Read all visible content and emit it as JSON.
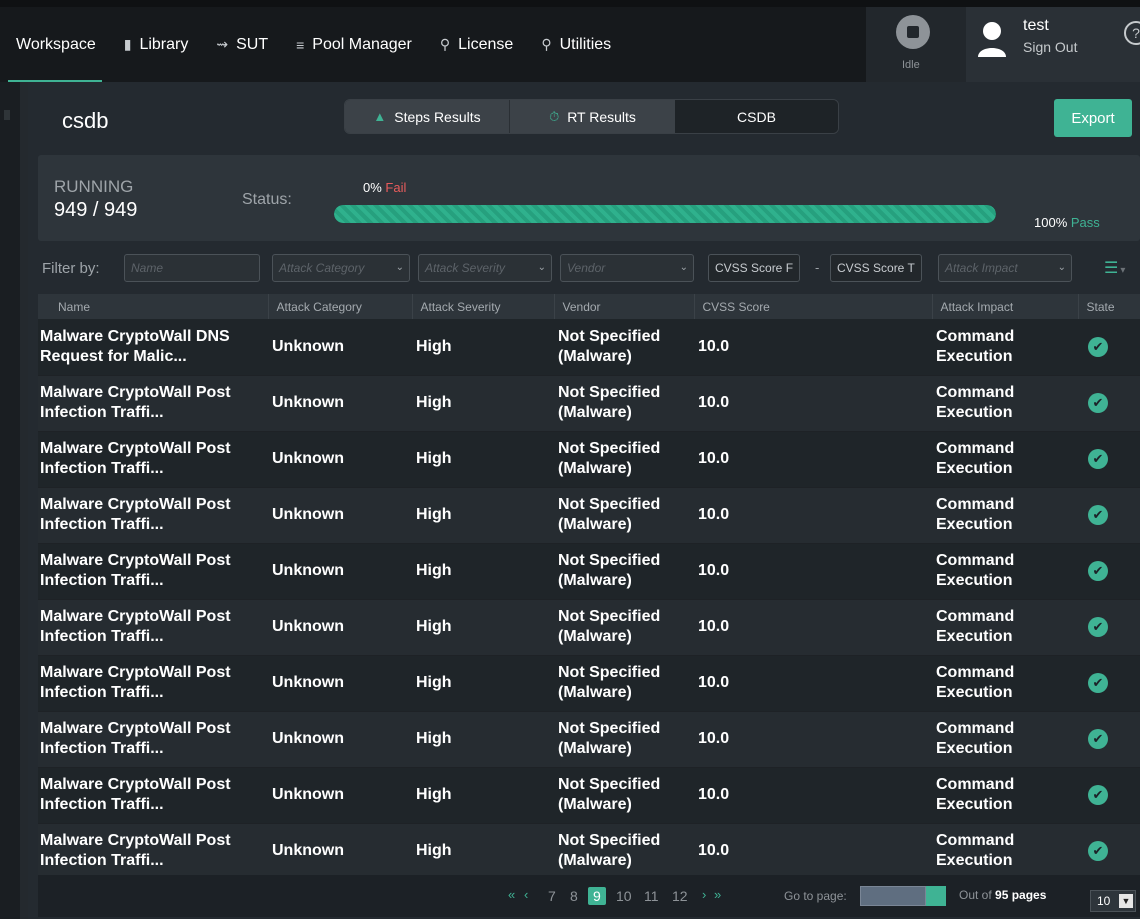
{
  "nav": {
    "items": [
      {
        "label": "Workspace",
        "icon": ""
      },
      {
        "label": "Library",
        "icon": "book-icon"
      },
      {
        "label": "SUT",
        "icon": "handshake-icon"
      },
      {
        "label": "Pool Manager",
        "icon": "layers-icon"
      },
      {
        "label": "License",
        "icon": "ribbon-icon"
      },
      {
        "label": "Utilities",
        "icon": "ribbon-icon"
      }
    ],
    "idle_label": "Idle",
    "user_name": "test",
    "sign_out": "Sign Out"
  },
  "header": {
    "title": "csdb",
    "tabs": [
      {
        "label": "Steps Results",
        "icon": "chart-icon"
      },
      {
        "label": "RT Results",
        "icon": "timer-icon"
      },
      {
        "label": "CSDB",
        "icon": ""
      }
    ],
    "export_label": "Export"
  },
  "status": {
    "state": "RUNNING",
    "count": "949 / 949",
    "status_label": "Status:",
    "fail_pct": "0%",
    "fail_word": "Fail",
    "pass_pct": "100%",
    "pass_word": "Pass",
    "progress_fraction": 1.0
  },
  "filters": {
    "label": "Filter by:",
    "name_placeholder": "Name",
    "category_placeholder": "Attack Category",
    "severity_placeholder": "Attack Severity",
    "vendor_placeholder": "Vendor",
    "cvss_from": "CVSS Score F",
    "cvss_sep": "-",
    "cvss_to": "CVSS Score T",
    "impact_placeholder": "Attack Impact"
  },
  "table": {
    "columns": [
      "Name",
      "Attack Category",
      "Attack Severity",
      "Vendor",
      "CVSS Score",
      "Attack Impact",
      "State"
    ],
    "rows": [
      {
        "name": "Malware CryptoWall DNS Request for Malic...",
        "category": "Unknown",
        "severity": "High",
        "vendor": "Not Specified (Malware)",
        "cvss": "10.0",
        "impact": "Command Execution",
        "state": "passed"
      },
      {
        "name": "Malware CryptoWall Post Infection Traffi...",
        "category": "Unknown",
        "severity": "High",
        "vendor": "Not Specified (Malware)",
        "cvss": "10.0",
        "impact": "Command Execution",
        "state": "passed"
      },
      {
        "name": "Malware CryptoWall Post Infection Traffi...",
        "category": "Unknown",
        "severity": "High",
        "vendor": "Not Specified (Malware)",
        "cvss": "10.0",
        "impact": "Command Execution",
        "state": "passed"
      },
      {
        "name": "Malware CryptoWall Post Infection Traffi...",
        "category": "Unknown",
        "severity": "High",
        "vendor": "Not Specified (Malware)",
        "cvss": "10.0",
        "impact": "Command Execution",
        "state": "passed"
      },
      {
        "name": "Malware CryptoWall Post Infection Traffi...",
        "category": "Unknown",
        "severity": "High",
        "vendor": "Not Specified (Malware)",
        "cvss": "10.0",
        "impact": "Command Execution",
        "state": "passed"
      },
      {
        "name": "Malware CryptoWall Post Infection Traffi...",
        "category": "Unknown",
        "severity": "High",
        "vendor": "Not Specified (Malware)",
        "cvss": "10.0",
        "impact": "Command Execution",
        "state": "passed"
      },
      {
        "name": "Malware CryptoWall Post Infection Traffi...",
        "category": "Unknown",
        "severity": "High",
        "vendor": "Not Specified (Malware)",
        "cvss": "10.0",
        "impact": "Command Execution",
        "state": "passed"
      },
      {
        "name": "Malware CryptoWall Post Infection Traffi...",
        "category": "Unknown",
        "severity": "High",
        "vendor": "Not Specified (Malware)",
        "cvss": "10.0",
        "impact": "Command Execution",
        "state": "passed"
      },
      {
        "name": "Malware CryptoWall Post Infection Traffi...",
        "category": "Unknown",
        "severity": "High",
        "vendor": "Not Specified (Malware)",
        "cvss": "10.0",
        "impact": "Command Execution",
        "state": "passed"
      },
      {
        "name": "Malware CryptoWall Post Infection Traffi...",
        "category": "Unknown",
        "severity": "High",
        "vendor": "Not Specified (Malware)",
        "cvss": "10.0",
        "impact": "Command Execution",
        "state": "passed"
      }
    ]
  },
  "pagination": {
    "pages": [
      "7",
      "8",
      "9",
      "10",
      "11",
      "12"
    ],
    "current": "9",
    "goto_label": "Go to page:",
    "out_of_prefix": "Out of",
    "total_pages": "95 pages",
    "page_size": "10"
  },
  "colors": {
    "accent": "#3fb394",
    "fail": "#e85c5c"
  }
}
